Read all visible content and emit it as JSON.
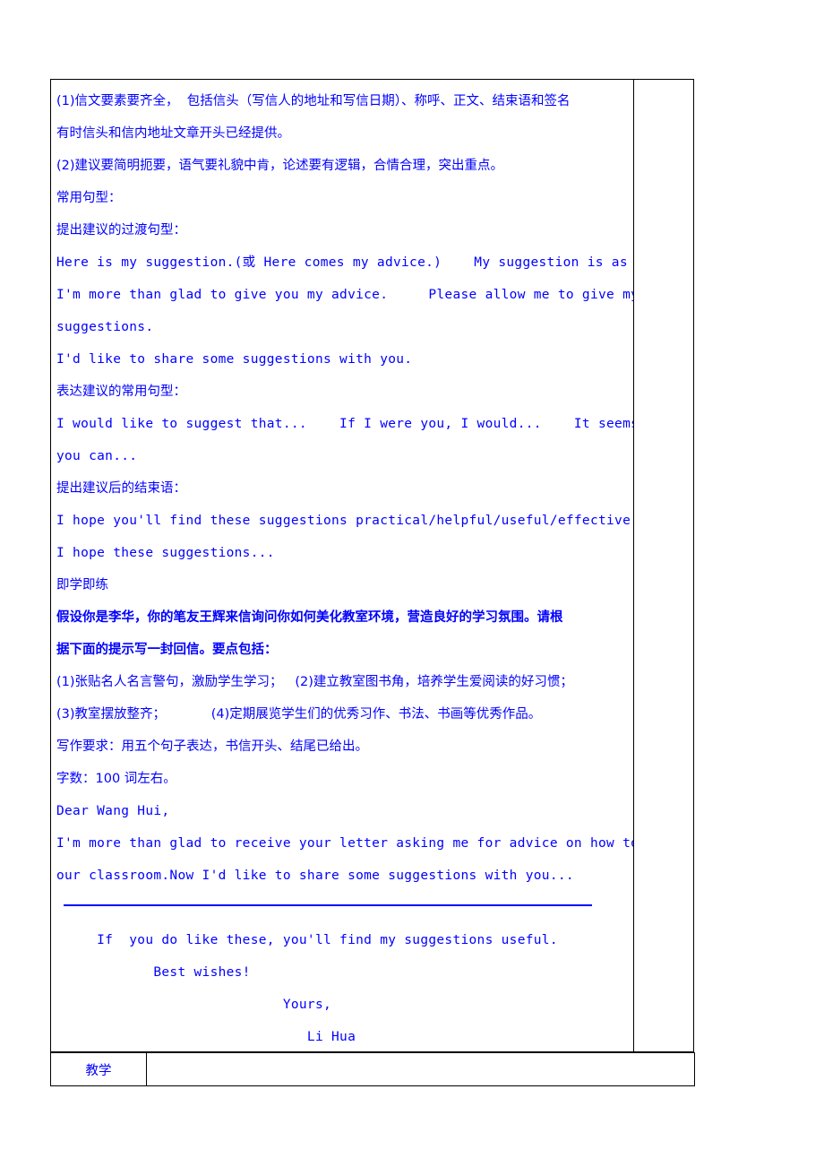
{
  "document": {
    "language": "zh-CN + en",
    "text_color": "#0000FF",
    "background_color": "#FFFFFF"
  },
  "main_cell": {
    "lines": [
      {
        "id": "l1",
        "style": "cn",
        "text": "(1)信文要素要齐全，  包括信头（写信人的地址和写信日期）、称呼、正文、结束语和签名"
      },
      {
        "id": "l2",
        "style": "cn",
        "text": "有时信头和信内地址文章开头已经提供。"
      },
      {
        "id": "l3",
        "style": "cn",
        "text": "(2)建议要简明扼要，语气要礼貌中肯，论述要有逻辑，合情合理，突出重点。"
      },
      {
        "id": "l4",
        "style": "cn",
        "text": "常用句型："
      },
      {
        "id": "l5",
        "style": "cn",
        "text": "提出建议的过渡句型："
      },
      {
        "id": "l6",
        "style": "en",
        "text": "Here is my suggestion.(或 Here comes my advice.)    My suggestion is as foll"
      },
      {
        "id": "l7",
        "style": "en",
        "text": "I'm more than glad to give you my advice.     Please allow me to give my"
      },
      {
        "id": "l8",
        "style": "en",
        "text": "suggestions."
      },
      {
        "id": "l9",
        "style": "en",
        "text": "I'd like to share some suggestions with you."
      },
      {
        "id": "l10",
        "style": "cn",
        "text": "表达建议的常用句型："
      },
      {
        "id": "l11",
        "style": "en",
        "text": "I would like to suggest that...    If I were you, I would...    It seems that"
      },
      {
        "id": "l12",
        "style": "en",
        "text": "you can..."
      },
      {
        "id": "l13",
        "style": "cn",
        "text": "提出建议后的结束语："
      },
      {
        "id": "l14",
        "style": "en",
        "text": "I hope you'll find these suggestions practical/helpful/useful/effective."
      },
      {
        "id": "l15",
        "style": "en",
        "text": "I hope these suggestions..."
      },
      {
        "id": "l16",
        "style": "cn",
        "text": "即学即练"
      },
      {
        "id": "l17",
        "style": "cn-bold",
        "text": "假设你是李华，你的笔友王辉来信询问你如何美化教室环境，营造良好的学习氛围。请根"
      },
      {
        "id": "l18",
        "style": "cn-bold",
        "text": "据下面的提示写一封回信。要点包括："
      },
      {
        "id": "l19",
        "style": "cn",
        "text": "(1)张贴名人名言警句，激励学生学习；   (2)建立教室图书角，培养学生爱阅读的好习惯；"
      },
      {
        "id": "l20",
        "style": "cn",
        "text": "(3)教室摆放整齐；           (4)定期展览学生们的优秀习作、书法、书画等优秀作品。"
      },
      {
        "id": "l21",
        "style": "cn",
        "text": "写作要求：用五个句子表达，书信开头、结尾已给出。"
      },
      {
        "id": "l22",
        "style": "cn",
        "text": "字数：100 词左右。"
      },
      {
        "id": "l23",
        "style": "en",
        "text": "Dear Wang Hui,"
      },
      {
        "id": "l24",
        "style": "en",
        "text": "I'm more than glad to receive your letter asking me for advice on how to beautify"
      },
      {
        "id": "l25",
        "style": "en",
        "text": "our classroom.Now I'd like to share some suggestions with you..."
      },
      {
        "id": "l26",
        "style": "rule",
        "text": ""
      },
      {
        "id": "l27",
        "style": "en",
        "text": "     If  you do like these, you'll find my suggestions useful."
      },
      {
        "id": "l28",
        "style": "en",
        "text": "            Best wishes!"
      },
      {
        "id": "l29",
        "style": "en",
        "text": "                            Yours,"
      },
      {
        "id": "l30",
        "style": "en",
        "text": "                               Li Hua"
      }
    ]
  },
  "side_cell": {
    "text": ""
  },
  "bottom_row": {
    "label": "教学",
    "value": ""
  }
}
